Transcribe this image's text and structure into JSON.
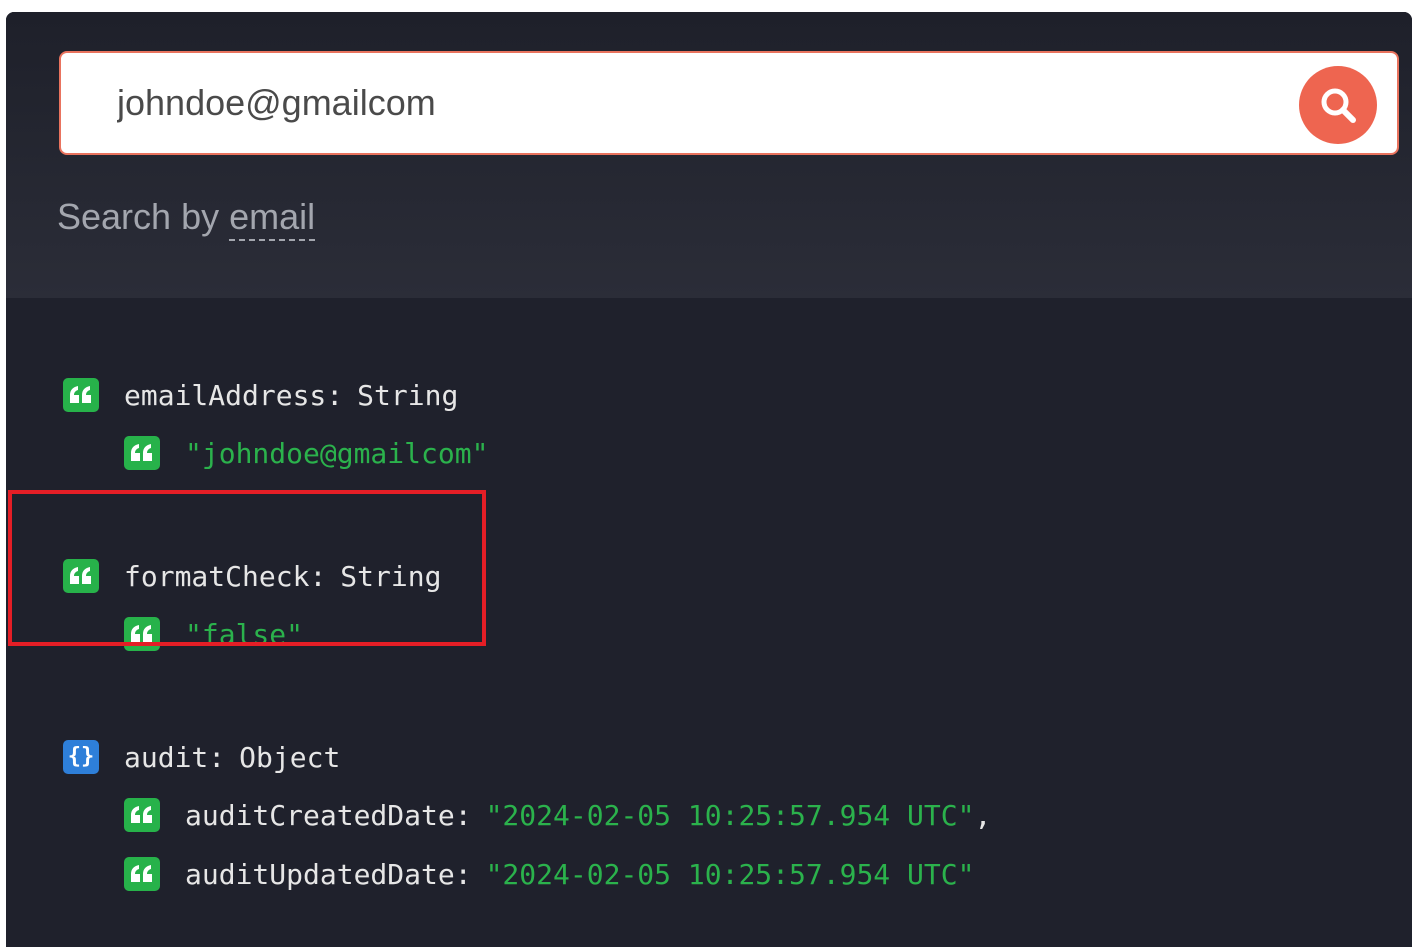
{
  "search": {
    "value": "johndoe@gmailcom",
    "hint_prefix": "Search by ",
    "hint_field": "email"
  },
  "fields": [
    {
      "key": "emailAddress",
      "type": "String",
      "value": "\"johndoe@gmailcom\""
    },
    {
      "key": "formatCheck",
      "type": "String",
      "value": "\"false\""
    },
    {
      "key": "audit",
      "type": "Object",
      "object_icon": "{}",
      "children": [
        {
          "key": "auditCreatedDate",
          "value": "\"2024-02-05 10:25:57.954 UTC\"",
          "suffix": ","
        },
        {
          "key": "auditUpdatedDate",
          "value": "\"2024-02-05 10:25:57.954 UTC\"",
          "suffix": ""
        }
      ]
    }
  ],
  "icons": {
    "search": "magnifier-icon",
    "string": "quote-icon",
    "object": "braces-icon"
  },
  "colors": {
    "panel_bg": "#1f212c",
    "accent": "#ee6550",
    "string_value": "#2bb24c",
    "string_icon": "#27b24a",
    "object_icon": "#2e7fd9",
    "highlight": "#e41e26"
  }
}
